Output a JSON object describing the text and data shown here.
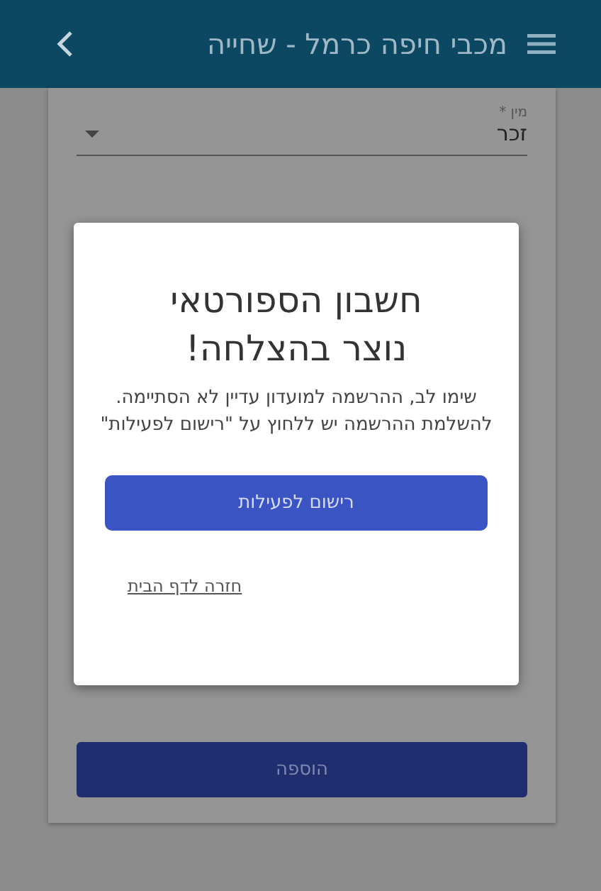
{
  "header": {
    "title": "מכבי חיפה כרמל - שחייה"
  },
  "form": {
    "gender_field": {
      "label": "מין *",
      "value": "זכר"
    },
    "submit_button": "הוספה"
  },
  "dialog": {
    "title": "חשבון הספורטאי נוצר בהצלחה!",
    "message": "שימו לב, ההרשמה למועדון עדיין לא הסתיימה. להשלמת ההרשמה יש ללחוץ על \"רישום לפעילות\"",
    "primary_button": "רישום לפעילות",
    "link": "חזרה לדף הבית"
  }
}
